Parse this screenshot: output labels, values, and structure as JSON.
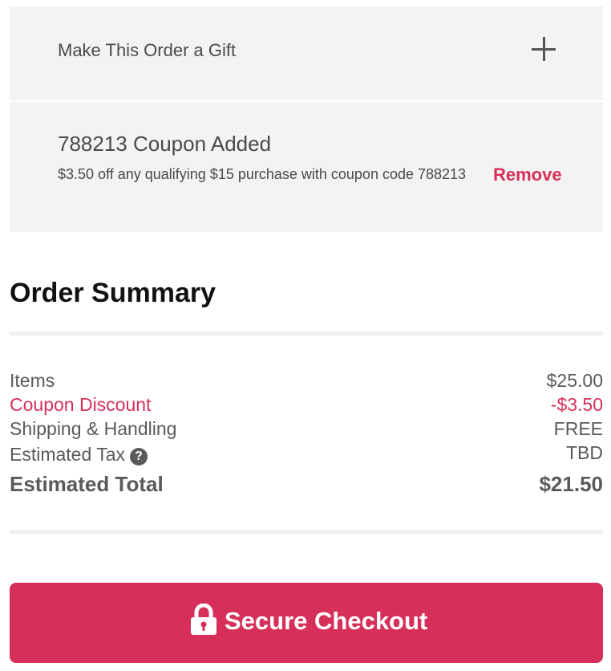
{
  "gift": {
    "title": "Make This Order a Gift",
    "icon": "plus-icon"
  },
  "coupon": {
    "title": "788213 Coupon Added",
    "description": "$3.50 off any qualifying $15 purchase with coupon code 788213",
    "remove_label": "Remove"
  },
  "summary": {
    "title": "Order Summary",
    "items_label": "Items",
    "items_value": "$25.00",
    "coupon_label": "Coupon Discount",
    "coupon_value": "-$3.50",
    "shipping_label": "Shipping & Handling",
    "shipping_value": "FREE",
    "tax_label": "Estimated Tax",
    "tax_help": "?",
    "tax_value": "TBD",
    "total_label": "Estimated Total",
    "total_value": "$21.50"
  },
  "checkout": {
    "label": "Secure Checkout",
    "icon": "lock-icon"
  },
  "colors": {
    "accent": "#d6305a",
    "panel_bg": "#f3f3f3",
    "text": "#5a5a5a"
  }
}
